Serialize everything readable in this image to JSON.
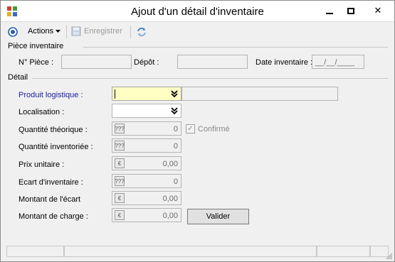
{
  "window": {
    "title": "Ajout d'un détail d'inventaire",
    "minimize_icon": "minimize-icon",
    "maximize_icon": "maximize-icon",
    "close_icon": "close-icon",
    "close_glyph": "✕"
  },
  "toolbar": {
    "actions_label": "Actions",
    "save_label": "Enregistrer",
    "save_enabled": false
  },
  "piece_section": {
    "title": "Pièce inventaire",
    "num_piece_label": "N° Pièce :",
    "num_piece_value": "",
    "depot_label": "Dépôt :",
    "depot_value": "",
    "date_label": "Date inventaire :",
    "date_value": "__/__/____"
  },
  "detail_section": {
    "title": "Détail",
    "produit_label": "Produit logistique :",
    "produit_value": "",
    "produit_desc": "",
    "localisation_label": "Localisation :",
    "localisation_value": "",
    "qte_theorique_label": "Quantité théorique :",
    "qte_theorique_value": "0",
    "confirme_label": "Confirmé",
    "confirme_checked": true,
    "qte_inventoriee_label": "Quantité inventoriée :",
    "qte_inventoriee_value": "0",
    "prix_unitaire_label": "Prix unitaire :",
    "prix_unitaire_value": "0,00",
    "ecart_label": "Ecart d'inventaire :",
    "ecart_value": "0",
    "montant_ecart_label": "Montant de l'écart",
    "montant_ecart_value": "0,00",
    "montant_charge_label": "Montant de charge :",
    "montant_charge_value": "0,00",
    "qty_icon_glyph": "???",
    "currency_icon_glyph": "€",
    "valider_label": "Valider"
  },
  "colors": {
    "accent_blue": "#1a1aa0",
    "active_field": "#ffffc4",
    "window_bg": "#f0f0f0"
  }
}
